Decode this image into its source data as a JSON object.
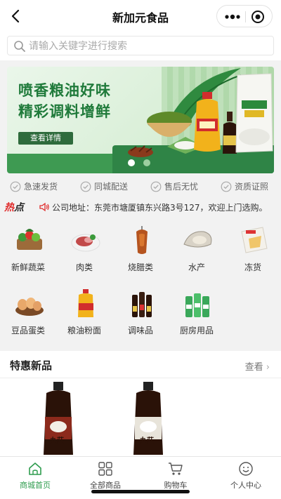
{
  "nav": {
    "title": "新加元食品",
    "back_icon": "chevron-left-icon",
    "more_icon": "more-dots-icon",
    "close_icon": "target-circle-icon"
  },
  "search": {
    "placeholder": "请输入关键字进行搜索"
  },
  "banner": {
    "line1": "喷香粮油好味",
    "line2": "精彩调料增鲜",
    "button": "查看详情",
    "active_dot": 0,
    "dot_count": 2
  },
  "guarantees": [
    {
      "label": "急速发货"
    },
    {
      "label": "同城配送"
    },
    {
      "label": "售后无忧"
    },
    {
      "label": "资质证照"
    }
  ],
  "notice": {
    "tag_hot": "热",
    "tag_point": "点",
    "text": "公司地址：东莞市塘厦镇东兴路3号127，欢迎上门选购。"
  },
  "categories": [
    {
      "label": "新鲜蔬菜",
      "icon": "vegetable-basket-icon"
    },
    {
      "label": "肉类",
      "icon": "meat-plate-icon"
    },
    {
      "label": "烧腊类",
      "icon": "roast-duck-icon"
    },
    {
      "label": "水产",
      "icon": "oyster-icon"
    },
    {
      "label": "冻货",
      "icon": "frozen-pack-icon"
    },
    {
      "label": "豆品蛋类",
      "icon": "eggs-icon"
    },
    {
      "label": "粮油粉面",
      "icon": "oil-bottle-icon"
    },
    {
      "label": "调味品",
      "icon": "sauce-bottles-icon"
    },
    {
      "label": "厨房用品",
      "icon": "kitchen-bottles-icon"
    }
  ],
  "section": {
    "title": "特惠新品",
    "more": "查看"
  },
  "products": [
    {
      "icon": "soy-sauce-bottle-icon",
      "brand": "丸莊"
    },
    {
      "icon": "soy-sauce-bottle-icon",
      "brand": "丸莊"
    }
  ],
  "tabbar": [
    {
      "label": "商城首页",
      "icon": "home-icon",
      "active": true
    },
    {
      "label": "全部商品",
      "icon": "grid-icon",
      "active": false
    },
    {
      "label": "购物车",
      "icon": "cart-icon",
      "active": false
    },
    {
      "label": "个人中心",
      "icon": "smile-icon",
      "active": false
    }
  ],
  "colors": {
    "accent": "#2e9c4e",
    "hot": "#e02b2b",
    "banner_text": "#1f7a3a"
  }
}
